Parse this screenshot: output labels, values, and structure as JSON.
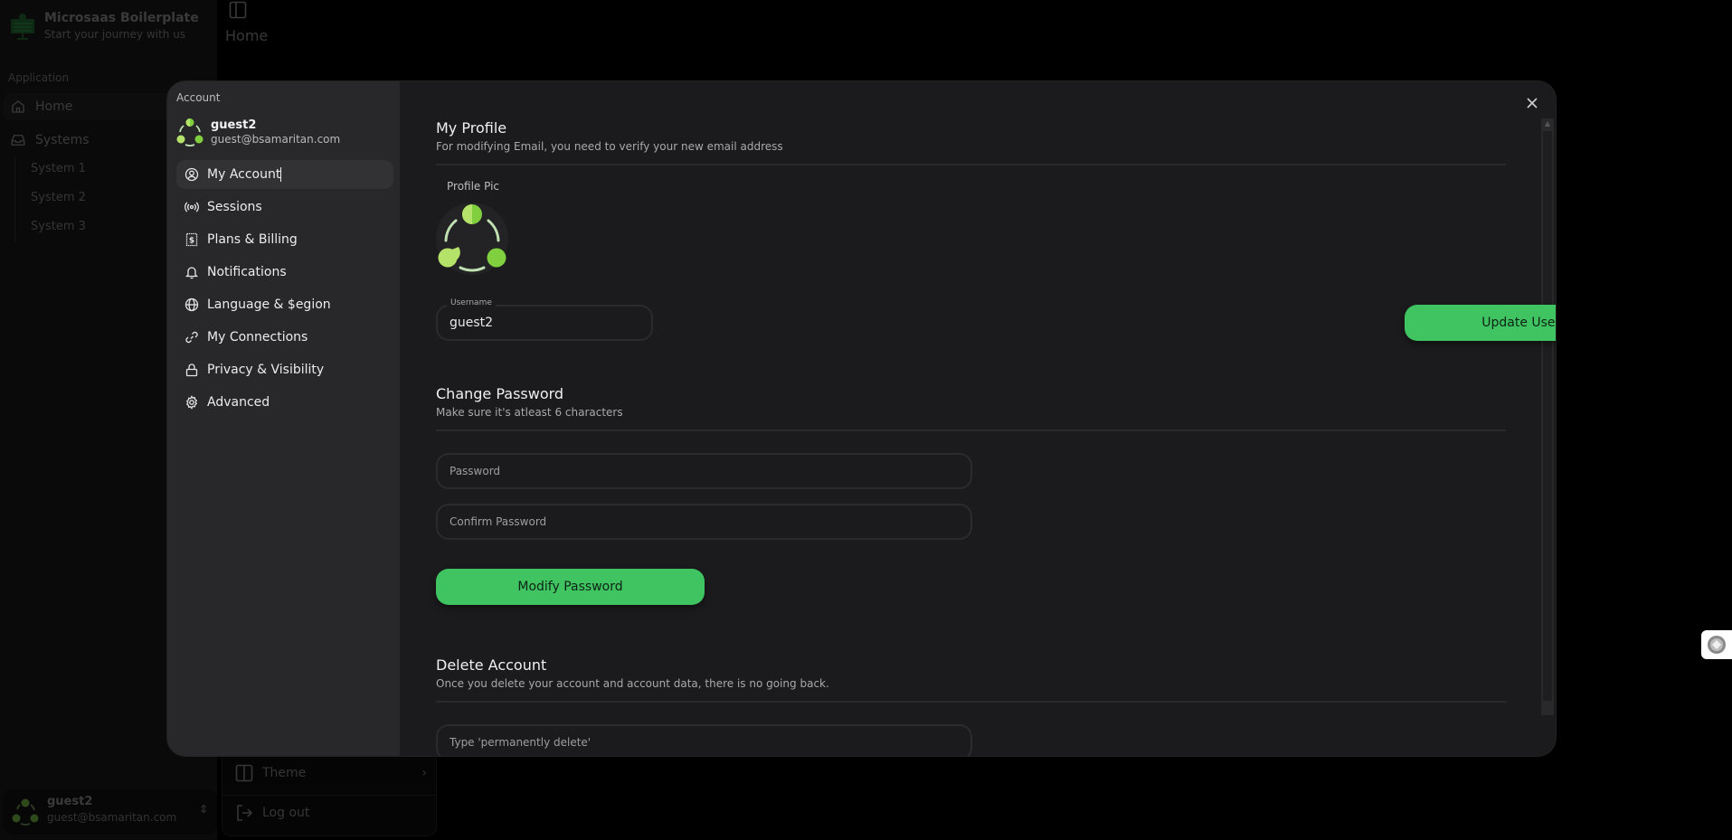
{
  "app": {
    "title": "Microsaas Boilerplate",
    "subtitle": "Start your journey with us",
    "section_label": "Application",
    "nav": [
      {
        "label": "Home",
        "icon": "home-icon"
      },
      {
        "label": "Systems",
        "icon": "inbox-icon"
      }
    ],
    "sub_nav": [
      "System 1",
      "System 2",
      "System 3"
    ],
    "page_heading": "Home",
    "user": {
      "name": "guest2",
      "email": "guest@bsamaritan.com"
    },
    "user_menu": {
      "theme_label": "Theme",
      "logout_label": "Log out"
    }
  },
  "modal": {
    "sidebar_title": "Account",
    "user": {
      "name": "guest2",
      "email": "guest@bsamaritan.com"
    },
    "items": [
      {
        "label": "My Account",
        "icon": "user-circle-icon",
        "active": true
      },
      {
        "label": "Sessions",
        "icon": "broadcast-icon"
      },
      {
        "label": "Plans & Billing",
        "icon": "billing-icon"
      },
      {
        "label": "Notifications",
        "icon": "bell-icon"
      },
      {
        "label": "Language & $egion",
        "icon": "globe-icon"
      },
      {
        "label": "My Connections",
        "icon": "link-icon"
      },
      {
        "label": "Privacy & Visibility",
        "icon": "lock-icon"
      },
      {
        "label": "Advanced",
        "icon": "gear-icon"
      }
    ],
    "profile": {
      "title": "My Profile",
      "subtitle": "For modifying Email, you need to verify your new email address",
      "pic_label": "Profile Pic",
      "username_label": "Username",
      "username_value": "guest2",
      "update_button": "Update Username"
    },
    "password": {
      "title": "Change Password",
      "subtitle": "Make sure it's atleast 6 characters",
      "password_placeholder": "Password",
      "confirm_placeholder": "Confirm Password",
      "modify_button": "Modify Password"
    },
    "delete": {
      "title": "Delete Account",
      "subtitle": "Once you delete your account and account data, there is no going back.",
      "confirm_placeholder": "Type 'permanently delete'"
    }
  },
  "colors": {
    "accent": "#3fc461",
    "modal_bg": "#1b1b1d",
    "modal_sidebar_bg": "#28282a",
    "avatar_green_light": "#b5e36a",
    "avatar_green": "#7fcf3f"
  }
}
